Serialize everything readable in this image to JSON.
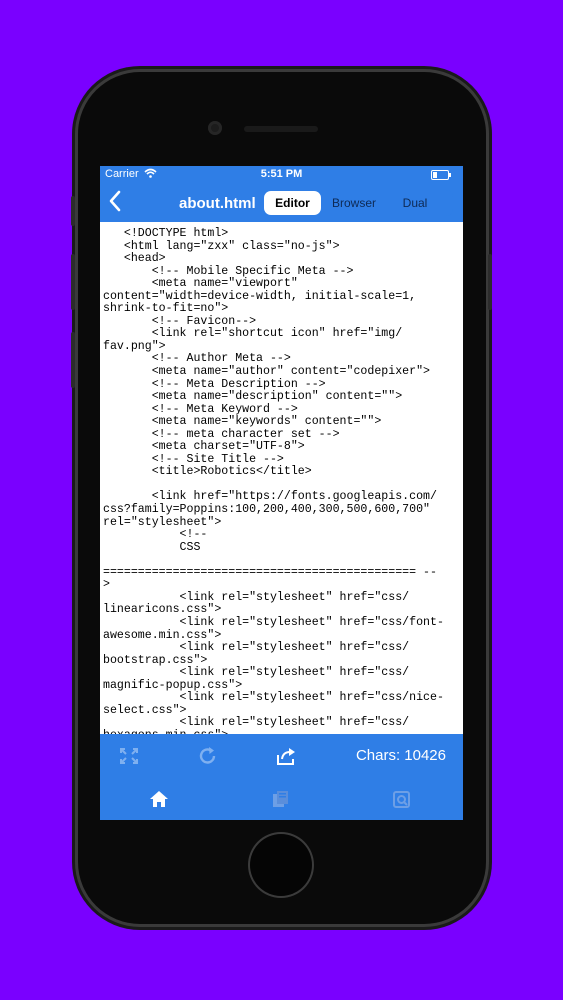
{
  "status_bar": {
    "carrier": "Carrier",
    "time": "5:51 PM"
  },
  "nav": {
    "title": "about.html",
    "back_icon": "chevron-left-icon",
    "segments": [
      "Editor",
      "Browser",
      "Dual"
    ],
    "selected_segment": "Editor"
  },
  "editor": {
    "content": "   <!DOCTYPE html>\n   <html lang=\"zxx\" class=\"no-js\">\n   <head>\n       <!-- Mobile Specific Meta -->\n       <meta name=\"viewport\"\ncontent=\"width=device-width, initial-scale=1,\nshrink-to-fit=no\">\n       <!-- Favicon-->\n       <link rel=\"shortcut icon\" href=\"img/\nfav.png\">\n       <!-- Author Meta -->\n       <meta name=\"author\" content=\"codepixer\">\n       <!-- Meta Description -->\n       <meta name=\"description\" content=\"\">\n       <!-- Meta Keyword -->\n       <meta name=\"keywords\" content=\"\">\n       <!-- meta character set -->\n       <meta charset=\"UTF-8\">\n       <!-- Site Title -->\n       <title>Robotics</title>\n\n       <link href=\"https://fonts.googleapis.com/\ncss?family=Poppins:100,200,400,300,500,600,700\"\nrel=\"stylesheet\">\n           <!--\n           CSS\n\n============================================= --\n>\n           <link rel=\"stylesheet\" href=\"css/\nlinearicons.css\">\n           <link rel=\"stylesheet\" href=\"css/font-\nawesome.min.css\">\n           <link rel=\"stylesheet\" href=\"css/\nbootstrap.css\">\n           <link rel=\"stylesheet\" href=\"css/\nmagnific-popup.css\">\n           <link rel=\"stylesheet\" href=\"css/nice-\nselect.css\">\n           <link rel=\"stylesheet\" href=\"css/\nhexagons.min.css\">"
  },
  "toolbar": {
    "icons": [
      "fullscreen-icon",
      "refresh-icon",
      "share-icon"
    ],
    "chars_label": "Chars: 10426"
  },
  "tab_bar": {
    "icons": [
      "home-icon",
      "files-icon",
      "search-icon"
    ]
  },
  "colors": {
    "background": "#7a00ff",
    "accent": "#2f7ee6",
    "phone_body": "#0a0a0a"
  }
}
